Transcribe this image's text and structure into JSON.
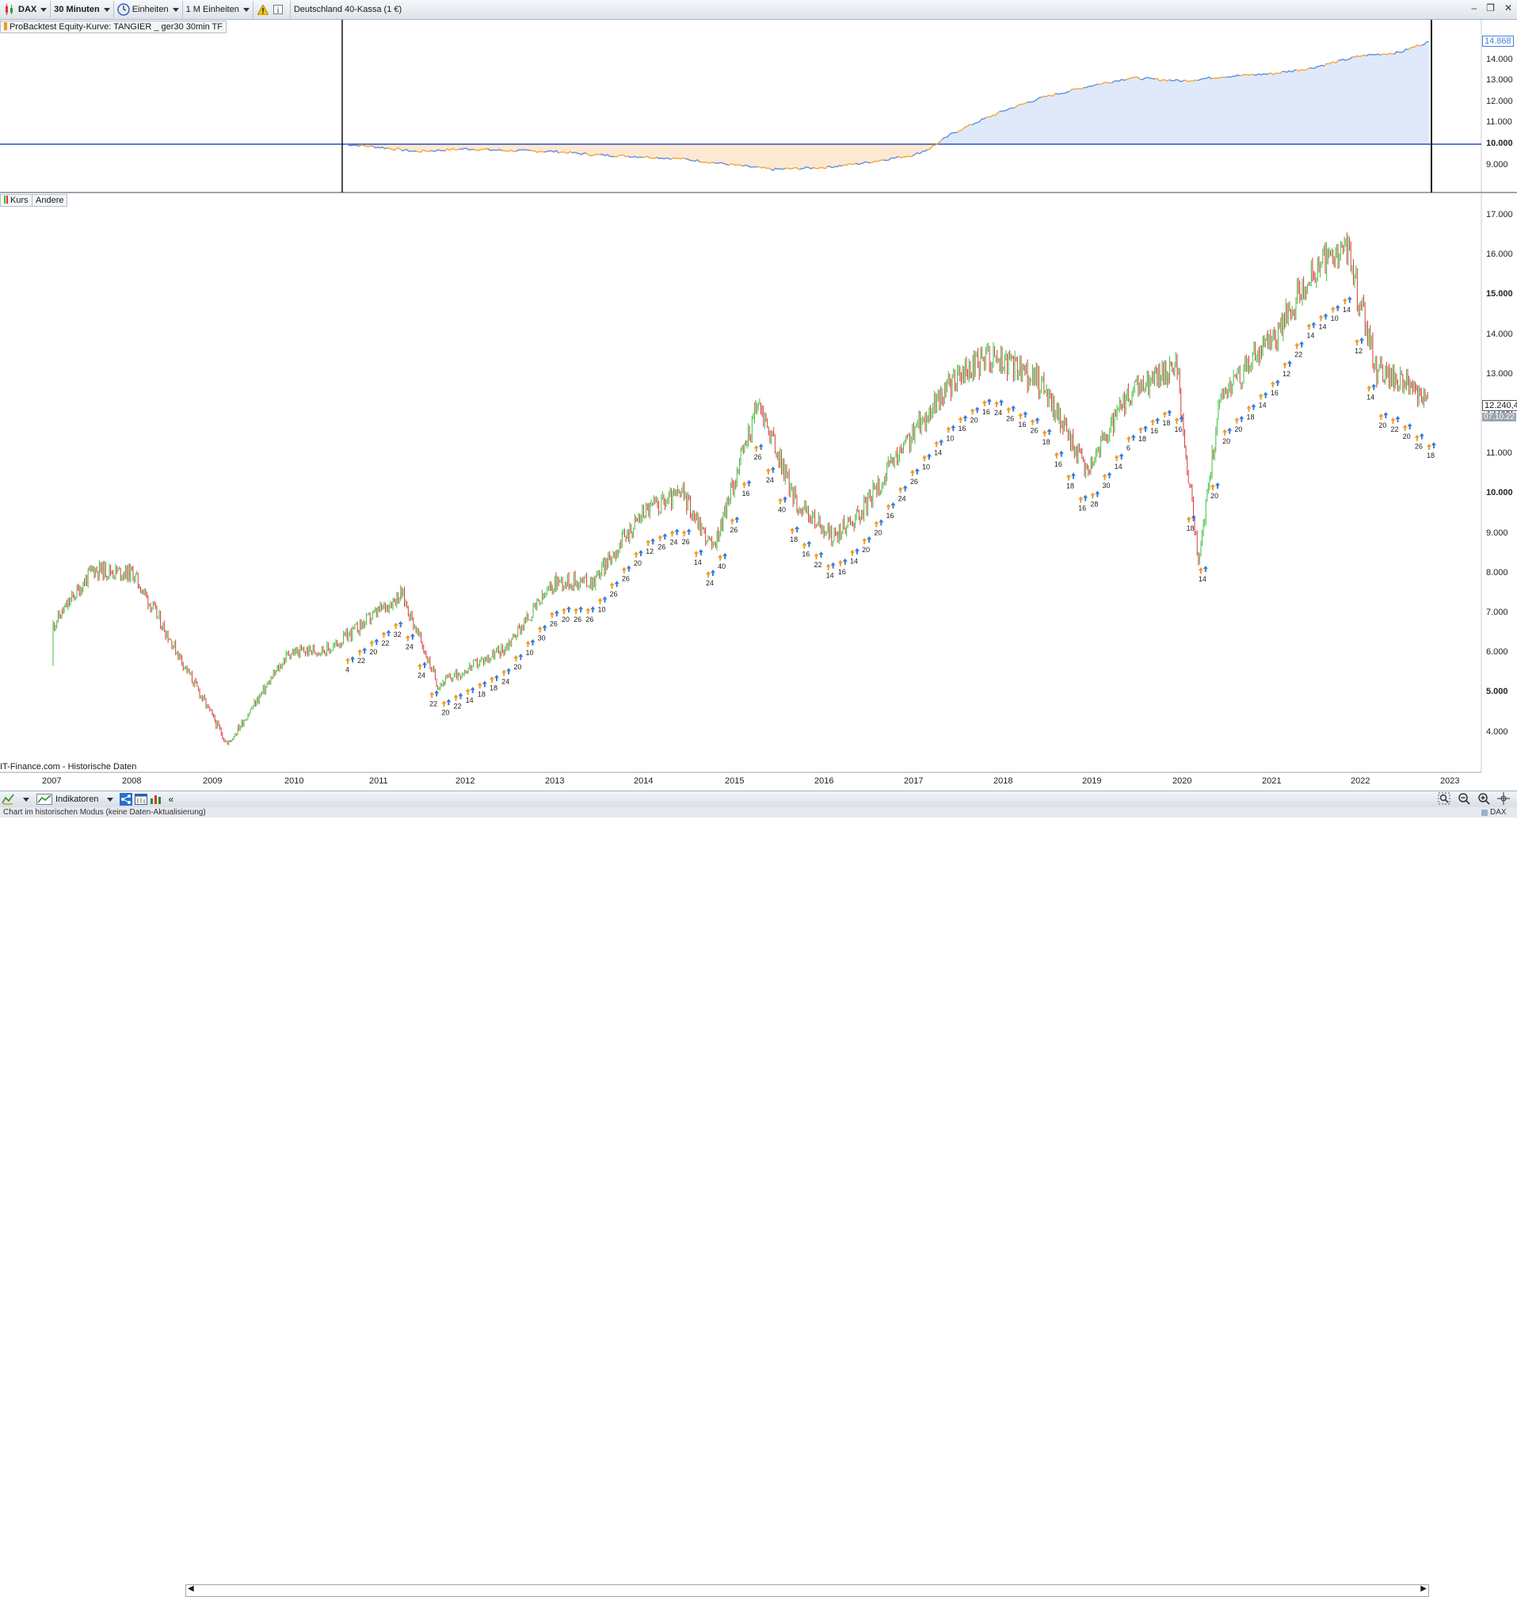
{
  "toolbar": {
    "symbol": "DAX",
    "interval": "30 Minuten",
    "units": "Einheiten",
    "units2": "1 M Einheiten",
    "instrument": "Deutschland 40-Kassa (1 €)"
  },
  "panels": {
    "equity_label": "ProBacktest Equity-Kurve: TANGIER _ ger30 30min TF",
    "price_label": "Kurs",
    "other_label": "Andere",
    "source": "IT-Finance.com - Historische Daten"
  },
  "equity_axis": [
    "14.000",
    "13.000",
    "12.000",
    "11.000",
    "10.000",
    "9.000"
  ],
  "equity_current": "14.868",
  "price_axis": [
    "17.000",
    "16.000",
    "15.000",
    "14.000",
    "13.000",
    "12.000",
    "11.000",
    "10.000",
    "9.000",
    "8.000",
    "7.000",
    "6.000",
    "5.000",
    "4.000"
  ],
  "price_current": "12.240,4",
  "price_date": "07.10.22",
  "years": [
    "2007",
    "2008",
    "2009",
    "2010",
    "2011",
    "2012",
    "2013",
    "2014",
    "2015",
    "2016",
    "2017",
    "2018",
    "2019",
    "2020",
    "2021",
    "2022",
    "2023"
  ],
  "bottombar": {
    "indicators": "Indikatoren",
    "dax_label": "DAX"
  },
  "status": "Chart im historischen Modus (keine Daten-Aktualisierung)",
  "trade_labels": [
    "4",
    "22",
    "20",
    "22",
    "32",
    "24",
    "24",
    "22",
    "20",
    "22",
    "14",
    "18",
    "18",
    "24",
    "20",
    "10",
    "30",
    "26",
    "20",
    "26",
    "26",
    "10",
    "26",
    "26",
    "20",
    "12",
    "26",
    "24",
    "26",
    "14",
    "24",
    "40",
    "26",
    "16",
    "26",
    "24",
    "40",
    "18",
    "16",
    "22",
    "14",
    "16",
    "14",
    "20",
    "20",
    "16",
    "24",
    "26",
    "10",
    "14",
    "10",
    "16",
    "20",
    "16",
    "24",
    "26",
    "16",
    "26",
    "18",
    "16",
    "18",
    "16",
    "28",
    "30",
    "14",
    "6",
    "18",
    "16",
    "18",
    "16",
    "18",
    "14",
    "20",
    "20",
    "20",
    "18",
    "14",
    "16",
    "12",
    "22",
    "14",
    "14",
    "10",
    "14",
    "12",
    "14",
    "20",
    "22",
    "20",
    "26",
    "18"
  ],
  "chart_data": [
    {
      "type": "area",
      "title": "ProBacktest Equity-Kurve: TANGIER _ ger30 30min TF",
      "x": [
        "2010-08",
        "2011-01",
        "2011-06",
        "2012-01",
        "2012-06",
        "2013-01",
        "2013-06",
        "2014-01",
        "2014-06",
        "2015-01",
        "2015-06",
        "2016-01",
        "2016-06",
        "2017-01",
        "2017-03",
        "2017-06",
        "2017-09",
        "2018-01",
        "2018-06",
        "2019-01",
        "2019-06",
        "2020-01",
        "2020-06",
        "2021-01",
        "2021-06",
        "2022-01",
        "2022-06",
        "2022-10"
      ],
      "values": [
        10000,
        9850,
        9650,
        9780,
        9700,
        9650,
        9500,
        9400,
        9300,
        9000,
        8800,
        8900,
        9100,
        9500,
        9800,
        10500,
        11000,
        11600,
        12200,
        12800,
        13150,
        13000,
        13200,
        13350,
        13600,
        14200,
        14350,
        14868
      ],
      "reference_line": 10000,
      "ylim": [
        8500,
        15200
      ]
    },
    {
      "type": "line",
      "title": "Kurs",
      "x": [
        "2006-06",
        "2007-01",
        "2007-07",
        "2008-01",
        "2008-06",
        "2009-03",
        "2009-12",
        "2010-06",
        "2011-04",
        "2011-09",
        "2012-06",
        "2013-01",
        "2013-06",
        "2014-01",
        "2014-06",
        "2014-10",
        "2015-04",
        "2015-09",
        "2016-02",
        "2016-06",
        "2017-01",
        "2017-06",
        "2017-11",
        "2018-06",
        "2018-12",
        "2019-06",
        "2019-12",
        "2020-03",
        "2020-06",
        "2021-01",
        "2021-06",
        "2021-11",
        "2022-03",
        "2022-06",
        "2022-10"
      ],
      "values": [
        5700,
        6700,
        8100,
        8000,
        6500,
        3700,
        6000,
        6100,
        7500,
        5200,
        6100,
        7800,
        7800,
        9600,
        10000,
        8600,
        12300,
        9800,
        8900,
        9600,
        11600,
        12800,
        13500,
        12800,
        10600,
        12500,
        13300,
        8300,
        12500,
        13900,
        15500,
        16200,
        13100,
        12900,
        12240.4
      ],
      "ylim": [
        3500,
        17300
      ]
    }
  ]
}
